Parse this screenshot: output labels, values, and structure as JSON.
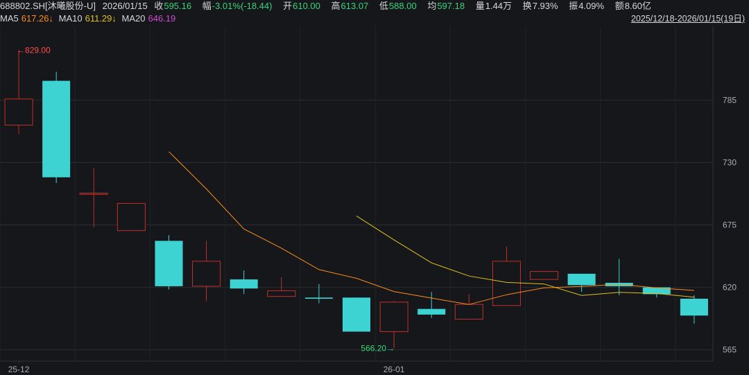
{
  "header": {
    "code": "688802.SH[沐曦股份-U]",
    "date": "2026/01/15",
    "close_label": "收",
    "close_value": "595.16",
    "change_label": "幅",
    "change_value": "-3.01%(-18.44)",
    "open_label": "开",
    "open_value": "610.00",
    "high_label": "高",
    "high_value": "613.07",
    "low_label": "低",
    "low_value": "588.00",
    "avg_label": "均",
    "avg_value": "597.18",
    "volume_label": "量",
    "volume_value": "1.44万",
    "turnover_label": "换",
    "turnover_value": "7.93%",
    "amplitude_label": "振",
    "amplitude_value": "4.09%",
    "amount_label": "额",
    "amount_value": "8.60亿"
  },
  "ma_legend": {
    "ma5_label": "MA5",
    "ma5_value": "617.26↓",
    "ma10_label": "MA10",
    "ma10_value": "611.29↓",
    "ma20_label": "MA20",
    "ma20_value": "646.19",
    "date_range": "2025/12/18-2026/01/15(19日)"
  },
  "colors": {
    "up": "#ff3b3b",
    "down": "#3ed3d3",
    "ma5": "#ff8c1a",
    "ma10": "#e3c21d",
    "ma20": "#d04ad0",
    "background": "#15171a",
    "grid": "#2a2d31"
  },
  "chart_data": {
    "type": "candlestick",
    "title": "",
    "ylim": [
      555,
      850
    ],
    "y_ticks": [
      "785",
      "730",
      "675",
      "620",
      "565"
    ],
    "x_tick_labels": [
      {
        "index": 0,
        "label": "25-12"
      },
      {
        "index": 10,
        "label": "26-01"
      }
    ],
    "high_marker": {
      "index": 0,
      "value": 829.0,
      "label": "829.00"
    },
    "low_marker": {
      "index": 10,
      "value": 566.2,
      "label": "566.20"
    },
    "candles": [
      {
        "open": 763,
        "close": 786,
        "high": 829,
        "low": 755
      },
      {
        "open": 802,
        "close": 717,
        "high": 810,
        "low": 712
      },
      {
        "open": 702,
        "close": 703,
        "high": 725,
        "low": 673
      },
      {
        "open": 670,
        "close": 694,
        "high": 694,
        "low": 670
      },
      {
        "open": 661,
        "close": 621,
        "high": 666,
        "low": 618
      },
      {
        "open": 621,
        "close": 643,
        "high": 661,
        "low": 608
      },
      {
        "open": 627,
        "close": 619,
        "high": 635,
        "low": 614
      },
      {
        "open": 612,
        "close": 617,
        "high": 629,
        "low": 612
      },
      {
        "open": 611,
        "close": 610,
        "high": 623,
        "low": 606
      },
      {
        "open": 611,
        "close": 581,
        "high": 611,
        "low": 581
      },
      {
        "open": 581,
        "close": 607,
        "high": 608,
        "low": 566.2
      },
      {
        "open": 601,
        "close": 596,
        "high": 616,
        "low": 593
      },
      {
        "open": 592,
        "close": 605,
        "high": 614,
        "low": 592
      },
      {
        "open": 604,
        "close": 643,
        "high": 656,
        "low": 604
      },
      {
        "open": 627,
        "close": 634,
        "high": 634,
        "low": 627
      },
      {
        "open": 632,
        "close": 622,
        "high": 632,
        "low": 616
      },
      {
        "open": 624,
        "close": 621,
        "high": 645,
        "low": 613
      },
      {
        "open": 620,
        "close": 614,
        "high": 620,
        "low": 611
      },
      {
        "open": 610,
        "close": 595.16,
        "high": 613.07,
        "low": 588
      }
    ],
    "series": [
      {
        "name": "MA5",
        "values": [
          null,
          null,
          null,
          null,
          739.6,
          706.7,
          671.5,
          654.5,
          635.7,
          628.0,
          616.3,
          610.6,
          604.9,
          613.5,
          619.6,
          620.8,
          622.8,
          619.5,
          617.3
        ]
      },
      {
        "name": "MA10",
        "values": [
          null,
          null,
          null,
          null,
          null,
          null,
          null,
          null,
          null,
          682.9,
          661.8,
          641.6,
          630.0,
          624.4,
          623.0,
          612.9,
          615.6,
          614.6,
          611.3
        ]
      }
    ]
  }
}
